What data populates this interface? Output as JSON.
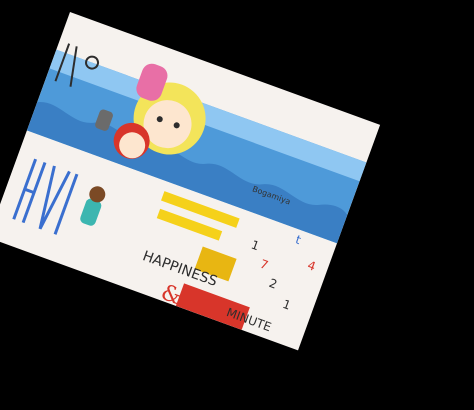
{
  "cover": {
    "title_handwritten": "HAPPINESS",
    "secondary_handwritten": "MINUTE",
    "ampersand": "&",
    "publisher_mark": "Bogamiya",
    "numbers": [
      "1",
      "7",
      "2",
      "t",
      "1",
      "4"
    ],
    "colors": {
      "background": "#000000",
      "paper": "#f6f2ee",
      "sky": "#4e9ad9",
      "sky_light": "#8fc7f2",
      "yellow": "#f5d11a",
      "pink": "#e86fa6",
      "red": "#d8352a",
      "teal": "#3cb6b0",
      "brown": "#7b4a25",
      "blonde": "#f3e45a"
    }
  }
}
